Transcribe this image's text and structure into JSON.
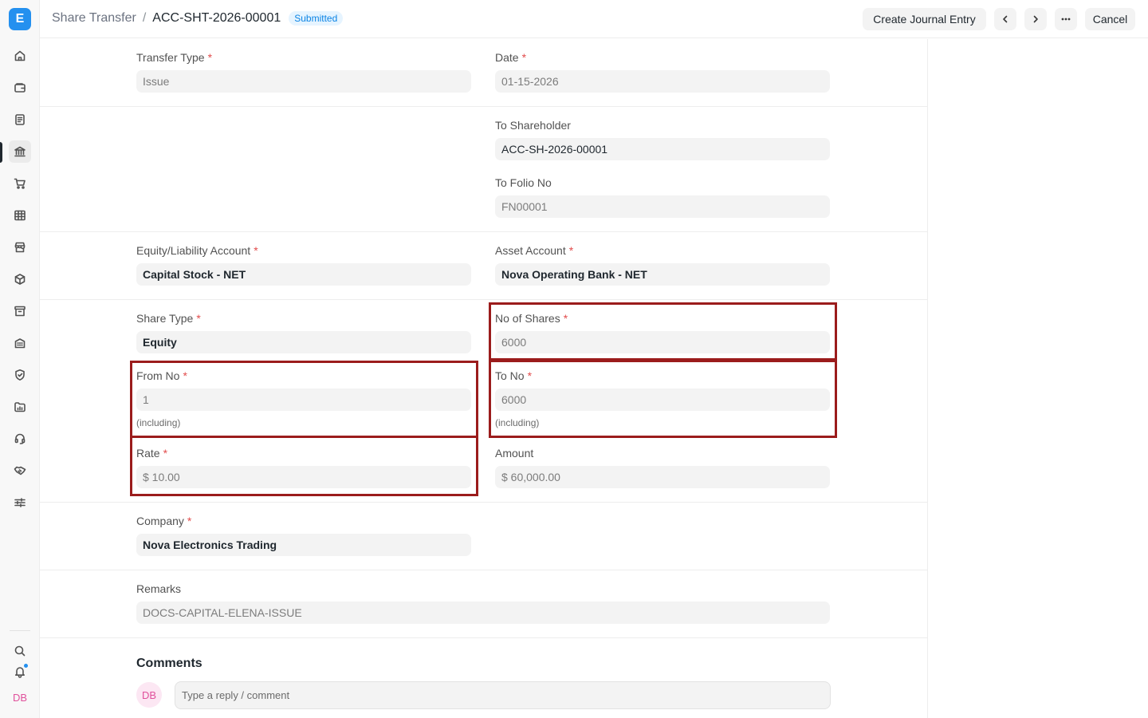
{
  "app": {
    "logo_letter": "E",
    "user_initials": "DB"
  },
  "breadcrumb": {
    "parent": "Share Transfer",
    "separator": "/",
    "current": "ACC-SHT-2026-00001",
    "status": "Submitted"
  },
  "toolbar": {
    "create_journal_entry": "Create Journal Entry",
    "cancel": "Cancel"
  },
  "form": {
    "transfer_type": {
      "label": "Transfer Type",
      "value": "Issue"
    },
    "date": {
      "label": "Date",
      "value": "01-15-2026"
    },
    "to_shareholder": {
      "label": "To Shareholder",
      "value": "ACC-SH-2026-00001"
    },
    "to_folio_no": {
      "label": "To Folio No",
      "value": "FN00001"
    },
    "equity_account": {
      "label": "Equity/Liability Account",
      "value": "Capital Stock - NET"
    },
    "asset_account": {
      "label": "Asset Account",
      "value": "Nova Operating Bank - NET"
    },
    "share_type": {
      "label": "Share Type",
      "value": "Equity"
    },
    "no_of_shares": {
      "label": "No of Shares",
      "value": "6000"
    },
    "from_no": {
      "label": "From No",
      "value": "1",
      "help": "(including)"
    },
    "to_no": {
      "label": "To No",
      "value": "6000",
      "help": "(including)"
    },
    "rate": {
      "label": "Rate",
      "value": "$ 10.00"
    },
    "amount": {
      "label": "Amount",
      "value": "$ 60,000.00"
    },
    "company": {
      "label": "Company",
      "value": "Nova Electronics Trading"
    },
    "remarks": {
      "label": "Remarks",
      "value": "DOCS-CAPITAL-ELENA-ISSUE"
    },
    "required_mark": "*"
  },
  "comments": {
    "title": "Comments",
    "avatar_initials": "DB",
    "placeholder": "Type a reply / comment"
  },
  "sidebar_icons": [
    "home-icon",
    "wallet-icon",
    "document-icon",
    "bank-icon",
    "cart-icon",
    "table-icon",
    "store-icon",
    "box-icon",
    "archive-icon",
    "building-icon",
    "shield-icon",
    "folder-icon",
    "headset-icon",
    "handshake-icon",
    "sliders-icon",
    "search-icon",
    "bell-icon"
  ],
  "colors": {
    "accent": "#2490ef",
    "status_badge": "#0b84e5",
    "highlight": "#9b1c1c",
    "required": "#e24c4c"
  }
}
